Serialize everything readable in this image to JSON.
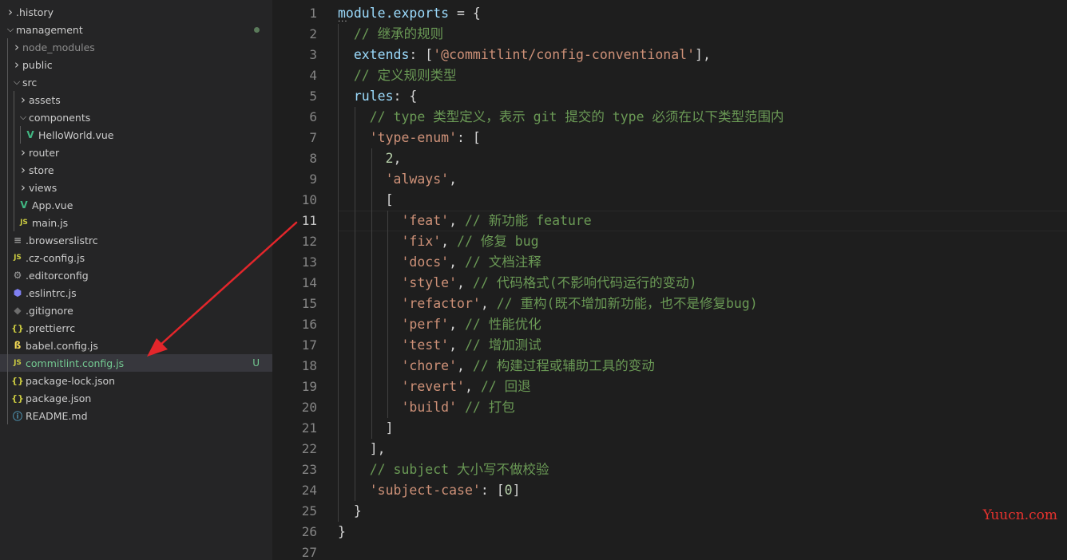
{
  "explorer": {
    "items": [
      {
        "label": ".history",
        "type": "folder",
        "open": false,
        "depth": 0
      },
      {
        "label": "management",
        "type": "folder",
        "open": true,
        "depth": 0,
        "modified": true
      },
      {
        "label": "node_modules",
        "type": "folder",
        "open": false,
        "depth": 1,
        "dim": true
      },
      {
        "label": "public",
        "type": "folder",
        "open": false,
        "depth": 1
      },
      {
        "label": "src",
        "type": "folder",
        "open": true,
        "depth": 1
      },
      {
        "label": "assets",
        "type": "folder",
        "open": false,
        "depth": 2
      },
      {
        "label": "components",
        "type": "folder",
        "open": true,
        "depth": 2
      },
      {
        "label": "HelloWorld.vue",
        "type": "vue",
        "depth": 3
      },
      {
        "label": "router",
        "type": "folder",
        "open": false,
        "depth": 2
      },
      {
        "label": "store",
        "type": "folder",
        "open": false,
        "depth": 2
      },
      {
        "label": "views",
        "type": "folder",
        "open": false,
        "depth": 2
      },
      {
        "label": "App.vue",
        "type": "vue",
        "depth": 2
      },
      {
        "label": "main.js",
        "type": "js",
        "depth": 2
      },
      {
        "label": ".browserslistrc",
        "type": "lines",
        "depth": 1
      },
      {
        "label": ".cz-config.js",
        "type": "js",
        "depth": 1
      },
      {
        "label": ".editorconfig",
        "type": "gear",
        "depth": 1
      },
      {
        "label": ".eslintrc.js",
        "type": "eslint",
        "depth": 1
      },
      {
        "label": ".gitignore",
        "type": "git",
        "depth": 1
      },
      {
        "label": ".prettierrc",
        "type": "json",
        "depth": 1
      },
      {
        "label": "babel.config.js",
        "type": "babel",
        "depth": 1
      },
      {
        "label": "commitlint.config.js",
        "type": "js",
        "depth": 1,
        "selected": true,
        "badge": "U"
      },
      {
        "label": "package-lock.json",
        "type": "json",
        "depth": 1
      },
      {
        "label": "package.json",
        "type": "json",
        "depth": 1
      },
      {
        "label": "README.md",
        "type": "info",
        "depth": 1
      }
    ]
  },
  "icons": {
    "folder_closed": "chevron-right-icon",
    "folder_open": "chevron-down-icon",
    "js": "js-file-icon",
    "vue": "vue-file-icon",
    "json": "json-braces-icon",
    "gear": "gear-icon",
    "eslint": "eslint-icon",
    "git": "git-icon",
    "babel": "babel-icon",
    "info": "info-icon",
    "lines": "lines-file-icon"
  },
  "icon_glyphs": {
    "js": "JS",
    "vue": "V",
    "json": "{}",
    "gear": "⚙",
    "eslint": "⬢",
    "git": "◆",
    "babel": "ß",
    "info": "ⓘ",
    "lines": "≡"
  },
  "editor": {
    "active_line": 11,
    "lines": [
      [
        {
          "t": "module.exports",
          "c": "var"
        },
        {
          "t": " = {",
          "c": "pun"
        }
      ],
      [
        {
          "t": "  // 继承的规则",
          "c": "cmt"
        }
      ],
      [
        {
          "t": "  extends",
          "c": "var"
        },
        {
          "t": ": [",
          "c": "pun"
        },
        {
          "t": "'@commitlint/config-conventional'",
          "c": "str"
        },
        {
          "t": "],",
          "c": "pun"
        }
      ],
      [
        {
          "t": "  // 定义规则类型",
          "c": "cmt"
        }
      ],
      [
        {
          "t": "  rules",
          "c": "var"
        },
        {
          "t": ": {",
          "c": "pun"
        }
      ],
      [
        {
          "t": "    // type 类型定义，表示 git 提交的 type 必须在以下类型范围内",
          "c": "cmt"
        }
      ],
      [
        {
          "t": "    ",
          "c": "pun"
        },
        {
          "t": "'type-enum'",
          "c": "str"
        },
        {
          "t": ": [",
          "c": "pun"
        }
      ],
      [
        {
          "t": "      ",
          "c": "pun"
        },
        {
          "t": "2",
          "c": "num"
        },
        {
          "t": ",",
          "c": "pun"
        }
      ],
      [
        {
          "t": "      ",
          "c": "pun"
        },
        {
          "t": "'always'",
          "c": "str"
        },
        {
          "t": ",",
          "c": "pun"
        }
      ],
      [
        {
          "t": "      [",
          "c": "pun"
        }
      ],
      [
        {
          "t": "        ",
          "c": "pun"
        },
        {
          "t": "'feat'",
          "c": "str"
        },
        {
          "t": ", ",
          "c": "pun"
        },
        {
          "t": "// 新功能 feature",
          "c": "cmt"
        }
      ],
      [
        {
          "t": "        ",
          "c": "pun"
        },
        {
          "t": "'fix'",
          "c": "str"
        },
        {
          "t": ", ",
          "c": "pun"
        },
        {
          "t": "// 修复 bug",
          "c": "cmt"
        }
      ],
      [
        {
          "t": "        ",
          "c": "pun"
        },
        {
          "t": "'docs'",
          "c": "str"
        },
        {
          "t": ", ",
          "c": "pun"
        },
        {
          "t": "// 文档注释",
          "c": "cmt"
        }
      ],
      [
        {
          "t": "        ",
          "c": "pun"
        },
        {
          "t": "'style'",
          "c": "str"
        },
        {
          "t": ", ",
          "c": "pun"
        },
        {
          "t": "// 代码格式(不影响代码运行的变动)",
          "c": "cmt"
        }
      ],
      [
        {
          "t": "        ",
          "c": "pun"
        },
        {
          "t": "'refactor'",
          "c": "str"
        },
        {
          "t": ", ",
          "c": "pun"
        },
        {
          "t": "// 重构(既不增加新功能，也不是修复bug)",
          "c": "cmt"
        }
      ],
      [
        {
          "t": "        ",
          "c": "pun"
        },
        {
          "t": "'perf'",
          "c": "str"
        },
        {
          "t": ", ",
          "c": "pun"
        },
        {
          "t": "// 性能优化",
          "c": "cmt"
        }
      ],
      [
        {
          "t": "        ",
          "c": "pun"
        },
        {
          "t": "'test'",
          "c": "str"
        },
        {
          "t": ", ",
          "c": "pun"
        },
        {
          "t": "// 增加测试",
          "c": "cmt"
        }
      ],
      [
        {
          "t": "        ",
          "c": "pun"
        },
        {
          "t": "'chore'",
          "c": "str"
        },
        {
          "t": ", ",
          "c": "pun"
        },
        {
          "t": "// 构建过程或辅助工具的变动",
          "c": "cmt"
        }
      ],
      [
        {
          "t": "        ",
          "c": "pun"
        },
        {
          "t": "'revert'",
          "c": "str"
        },
        {
          "t": ", ",
          "c": "pun"
        },
        {
          "t": "// 回退",
          "c": "cmt"
        }
      ],
      [
        {
          "t": "        ",
          "c": "pun"
        },
        {
          "t": "'build'",
          "c": "str"
        },
        {
          "t": " ",
          "c": "pun"
        },
        {
          "t": "// 打包",
          "c": "cmt"
        }
      ],
      [
        {
          "t": "      ]",
          "c": "pun"
        }
      ],
      [
        {
          "t": "    ],",
          "c": "pun"
        }
      ],
      [
        {
          "t": "    // subject 大小写不做校验",
          "c": "cmt"
        }
      ],
      [
        {
          "t": "    ",
          "c": "pun"
        },
        {
          "t": "'subject-case'",
          "c": "str"
        },
        {
          "t": ": [",
          "c": "pun"
        },
        {
          "t": "0",
          "c": "num"
        },
        {
          "t": "]",
          "c": "pun"
        }
      ],
      [
        {
          "t": "  }",
          "c": "pun"
        }
      ],
      [
        {
          "t": "}",
          "c": "pun"
        }
      ],
      []
    ]
  },
  "watermark": "Yuucn.com",
  "colors": {
    "sidebar_bg": "#252526",
    "editor_bg": "#1e1e1e",
    "git_untracked": "#73c991",
    "annotation_arrow": "#e3262b"
  }
}
